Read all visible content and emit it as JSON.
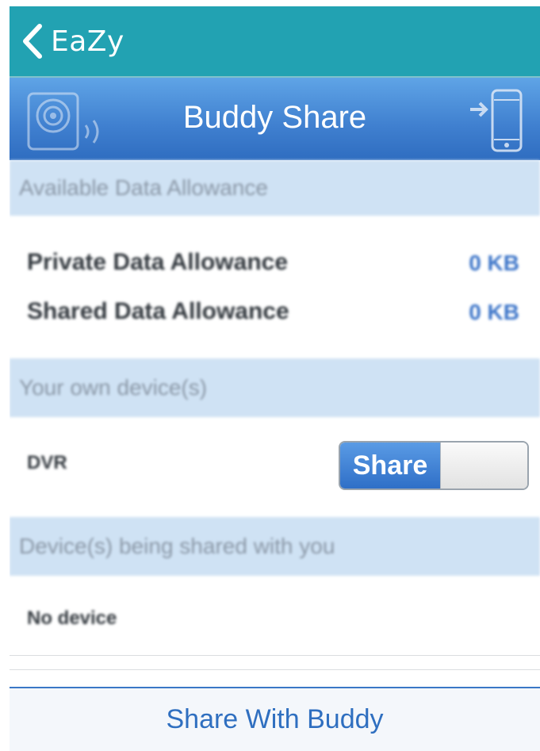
{
  "navbar": {
    "back_label": "EaZy"
  },
  "header": {
    "title": "Buddy Share",
    "left_icon": "camera-wifi-icon",
    "right_icon": "phone-transfer-icon"
  },
  "sections": {
    "allowance": {
      "title": "Available Data Allowance",
      "private_label": "Private Data Allowance",
      "private_value": "0 KB",
      "shared_label": "Shared Data Allowance",
      "shared_value": "0 KB"
    },
    "own_devices": {
      "title": "Your own device(s)",
      "device_name": "DVR",
      "toggle_label": "Share"
    },
    "shared_with_you": {
      "title": "Device(s) being shared with you",
      "empty_text": "No device"
    }
  },
  "bottom_button": {
    "label": "Share With Buddy"
  },
  "colors": {
    "navbar": "#22a2b2",
    "header_blue": "#3f7fcf",
    "section_bg": "#cfe2f4",
    "accent": "#2f6fc0"
  }
}
